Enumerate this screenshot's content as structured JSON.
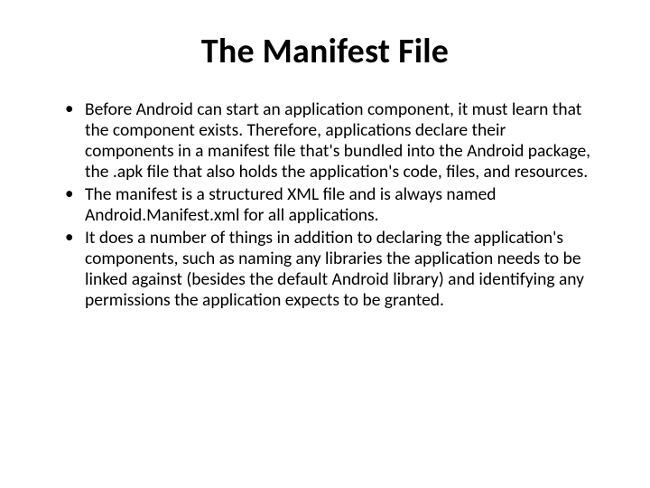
{
  "slide": {
    "title": "The Manifest File",
    "bullets": [
      "Before Android can start an application component, it must learn that the component exists. Therefore, applications declare their components in a manifest file that's bundled into the Android package, the .apk file that also holds the application's code, files, and resources.",
      "The manifest is a structured XML file and is always named Android.Manifest.xml for all applications.",
      "It does a number of things in addition to declaring the application's components, such as naming any libraries the application needs to be linked against (besides the default Android library) and identifying any permissions the application expects to be granted."
    ]
  }
}
